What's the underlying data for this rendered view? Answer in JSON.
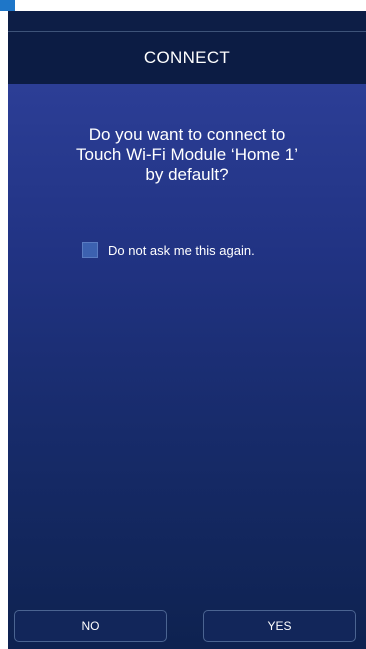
{
  "header": {
    "title": "CONNECT"
  },
  "dialog": {
    "question_lines": [
      "Do you want to connect to",
      "Touch Wi-Fi Module ‘Home 1’",
      "by default?"
    ],
    "checkbox_label": "Do not ask me this again.",
    "checkbox_checked": false
  },
  "buttons": {
    "no_label": "NO",
    "yes_label": "YES"
  },
  "colors": {
    "header_bg": "#0c1c44",
    "content_top": "#2c3e96",
    "content_bottom": "#0e2250",
    "checkbox_fill": "#3c61b0",
    "button_bg": "#12265a",
    "corner_tab": "#1e76c8"
  }
}
